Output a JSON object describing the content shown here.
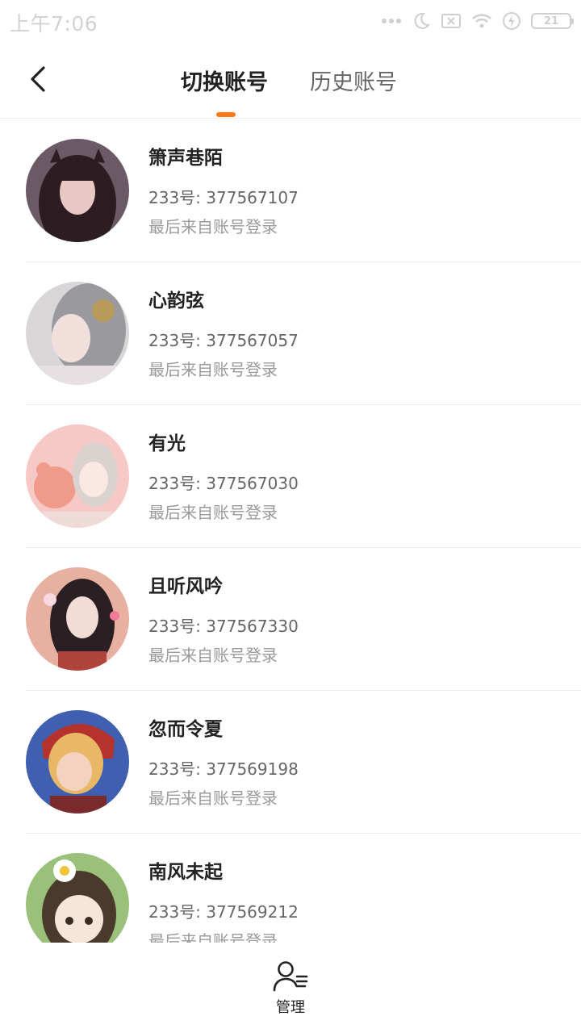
{
  "status_bar": {
    "time": "上午7:06",
    "battery": "21",
    "icons": [
      "more-dots-icon",
      "moon-icon",
      "sim-off-icon",
      "wifi-icon",
      "charging-icon",
      "battery-icon"
    ]
  },
  "header": {
    "back_icon": "chevron-left-icon",
    "tabs": [
      {
        "label": "切换账号",
        "active": true
      },
      {
        "label": "历史账号",
        "active": false
      }
    ],
    "accent_color": "#ff7a1a"
  },
  "accounts": [
    {
      "name": "箫声巷陌",
      "uid": "233号: 377567107",
      "last_login": "最后来自账号登录"
    },
    {
      "name": "心韵弦",
      "uid": "233号: 377567057",
      "last_login": "最后来自账号登录"
    },
    {
      "name": "有光",
      "uid": "233号: 377567030",
      "last_login": "最后来自账号登录"
    },
    {
      "name": "且听风吟",
      "uid": "233号: 377567330",
      "last_login": "最后来自账号登录"
    },
    {
      "name": "忽而令夏",
      "uid": "233号: 377569198",
      "last_login": "最后来自账号登录"
    },
    {
      "name": "南风未起",
      "uid": "233号: 377569212",
      "last_login": "最后来自账号登录"
    }
  ],
  "bottom_bar": {
    "manage_icon": "user-manage-icon",
    "manage_label": "管理"
  }
}
